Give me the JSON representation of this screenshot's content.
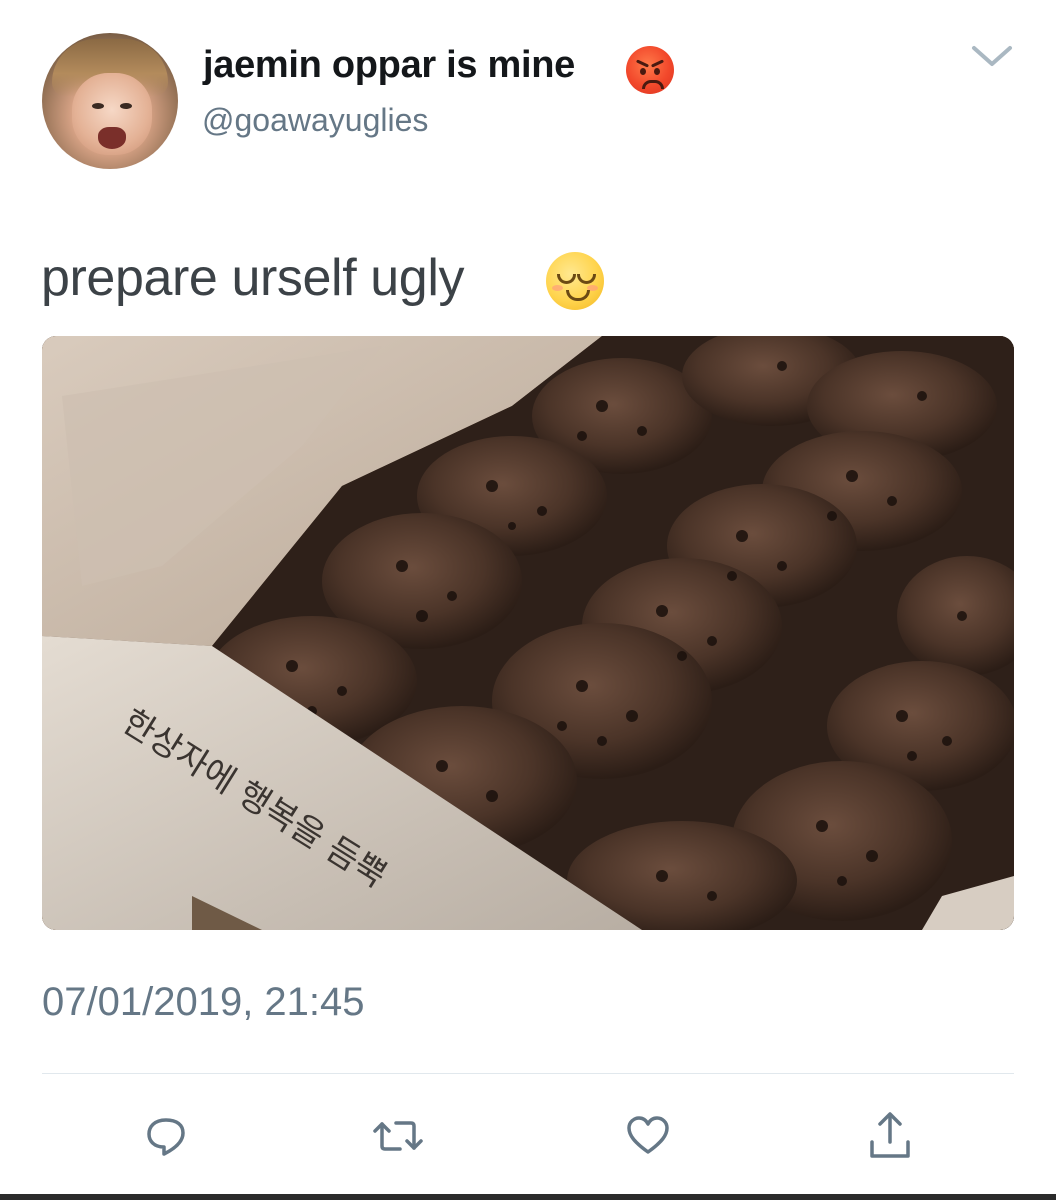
{
  "tweet": {
    "author": {
      "display_name": "jaemin oppar is mine",
      "name_emoji": "angry-face-emoji",
      "handle": "@goawayuglies",
      "avatar": "profile-photo"
    },
    "menu_icon": "chevron-down-icon",
    "text": "prepare urself ugly",
    "text_emoji": "relieved-face-emoji",
    "media": {
      "description_icon": "photo",
      "box_text": "한상자에 행복을 듬뿍"
    },
    "timestamp": "07/01/2019, 21:45",
    "actions": [
      {
        "name": "reply",
        "icon": "speech-bubble-icon"
      },
      {
        "name": "retweet",
        "icon": "retweet-arrows-icon"
      },
      {
        "name": "like",
        "icon": "heart-icon"
      },
      {
        "name": "share",
        "icon": "share-upload-icon"
      }
    ],
    "colors": {
      "text_primary": "#14171a",
      "text_secondary": "#657786",
      "divider": "#e1e8ed"
    }
  }
}
